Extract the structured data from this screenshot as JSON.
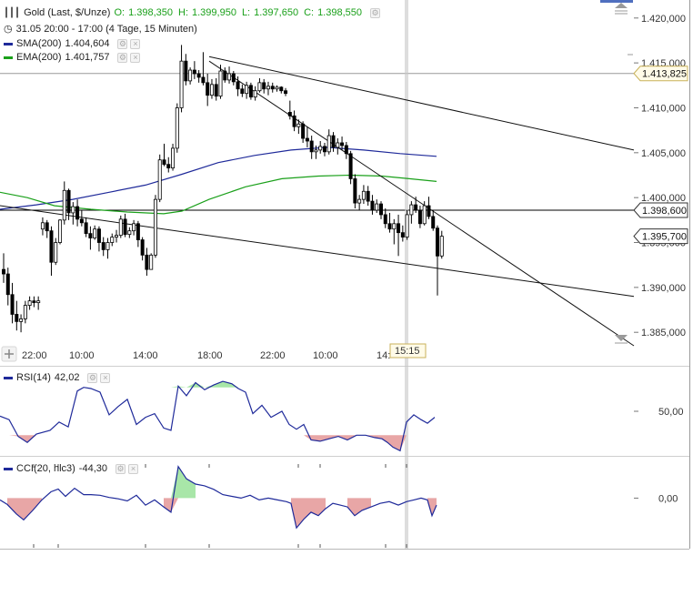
{
  "legend": {
    "main": {
      "title": "Gold (Last, $/Unze)",
      "o_label": "O:",
      "o": "1.398,350",
      "h_label": "H:",
      "h": "1.399,950",
      "l_label": "L:",
      "l": "1.397,650",
      "c_label": "C:",
      "c": "1.398,550"
    },
    "period": "31.05 20:00 - 17:00 (4 Tage, 15 Minuten)",
    "sma": {
      "label": "SMA(200)",
      "value": "1.404,604",
      "color": "#1f2a9a"
    },
    "ema": {
      "label": "EMA(200)",
      "value": "1.401,757",
      "color": "#1aa01a"
    },
    "rsi": {
      "label": "RSI(14)",
      "value": "42,02"
    },
    "cci": {
      "label": "CCI(20, hlc3)",
      "value": "-44,30"
    }
  },
  "price_axis": {
    "ticks": [
      "1.420,000",
      "1.415,000",
      "1.410,000",
      "1.405,000",
      "1.400,000",
      "1.395,000",
      "1.390,000",
      "1.385,000"
    ],
    "tick_values": [
      1420,
      1415,
      1410,
      1405,
      1400,
      1395,
      1390,
      1385
    ],
    "marker_hline": {
      "value": 1413.825,
      "label": "1.413,825"
    },
    "marker_last": {
      "value": 1398.6,
      "label": "1.398,600"
    },
    "marker_cursor": {
      "value": 1395.7,
      "label": "1.395,700"
    }
  },
  "time_axis": {
    "ticks": [
      "22:00",
      "10:00",
      "14:00",
      "18:00",
      "22:00",
      "10:00",
      "14:"
    ],
    "cursor_label": "15:15"
  },
  "rsi_axis": {
    "tick": "50,00",
    "tick_value": 50
  },
  "cci_axis": {
    "tick": "0,00",
    "tick_value": 0
  },
  "colors": {
    "up": "#ffffff",
    "down": "#000000",
    "sma": "#1f2a9a",
    "ema": "#1aa01a",
    "indicator": "#1f2a9a",
    "fill_up": "#a8e6a8",
    "fill_down": "#e8a6a6"
  },
  "chart_data": {
    "type": "candlestick",
    "ylim": [
      1383.5,
      1421.5
    ],
    "candles": [
      [
        1392,
        1393.8,
        1390.5,
        1391.5
      ],
      [
        1391.5,
        1392.2,
        1388,
        1389.2
      ],
      [
        1389.2,
        1390.5,
        1386,
        1387
      ],
      [
        1387,
        1388.5,
        1385.2,
        1386.2
      ],
      [
        1386.2,
        1387,
        1385,
        1386.5
      ],
      [
        1386.5,
        1388.5,
        1386,
        1388
      ],
      [
        1388,
        1389,
        1387.5,
        1388.5
      ],
      [
        1388.5,
        1389,
        1387.8,
        1388.3
      ],
      [
        1388.3,
        1389,
        1387.5,
        1388.5
      ],
      [
        1396.5,
        1397.8,
        1395.8,
        1397.2
      ],
      [
        1397.2,
        1397.5,
        1395.5,
        1396.3
      ],
      [
        1396.3,
        1396.8,
        1391.3,
        1392.8
      ],
      [
        1392.8,
        1395.5,
        1392.5,
        1395
      ],
      [
        1395,
        1397.6,
        1394.8,
        1397.5
      ],
      [
        1397.5,
        1401.8,
        1397,
        1400.8
      ],
      [
        1400.8,
        1401,
        1397.5,
        1398.3
      ],
      [
        1398.3,
        1399.5,
        1397,
        1399
      ],
      [
        1399,
        1399.8,
        1396.8,
        1397.6
      ],
      [
        1397.6,
        1398.6,
        1396.8,
        1397.2
      ],
      [
        1397.2,
        1397.8,
        1395.6,
        1396
      ],
      [
        1396,
        1396.8,
        1394.2,
        1395.5
      ],
      [
        1395.5,
        1396.9,
        1395.3,
        1396.5
      ],
      [
        1396.5,
        1396.8,
        1394,
        1395
      ],
      [
        1395,
        1395.6,
        1393.5,
        1394.2
      ],
      [
        1394.2,
        1395.5,
        1393.2,
        1395
      ],
      [
        1395,
        1396,
        1394.6,
        1395.6
      ],
      [
        1395.6,
        1396.4,
        1395,
        1395.8
      ],
      [
        1395.8,
        1398,
        1395.5,
        1397.6
      ],
      [
        1397.6,
        1398.2,
        1395.6,
        1395.9
      ],
      [
        1395.9,
        1396.7,
        1395.5,
        1396.3
      ],
      [
        1396.3,
        1397.5,
        1395.8,
        1397.1
      ],
      [
        1397.1,
        1397.4,
        1394.5,
        1395.3
      ],
      [
        1395.3,
        1395.6,
        1393,
        1393.6
      ],
      [
        1393.6,
        1394.4,
        1391.3,
        1392
      ],
      [
        1392,
        1393.8,
        1392,
        1393.6
      ],
      [
        1393.6,
        1400.3,
        1393.3,
        1399.8
      ],
      [
        1399.8,
        1404.8,
        1399.5,
        1404.2
      ],
      [
        1404.2,
        1406,
        1403.5,
        1403.7
      ],
      [
        1403.7,
        1404.5,
        1402.8,
        1403.3
      ],
      [
        1403.3,
        1406,
        1403,
        1405.5
      ],
      [
        1405.5,
        1410.5,
        1405,
        1410
      ],
      [
        1410,
        1417,
        1409.5,
        1415.2
      ],
      [
        1415.2,
        1416,
        1412.5,
        1413
      ],
      [
        1413,
        1414.5,
        1412.6,
        1414.2
      ],
      [
        1414.2,
        1415.2,
        1413.2,
        1413.8
      ],
      [
        1413.8,
        1414.2,
        1412.8,
        1413.4
      ],
      [
        1413.4,
        1416.2,
        1412.5,
        1412.8
      ],
      [
        1412.8,
        1413.8,
        1410.2,
        1411.4
      ],
      [
        1411.4,
        1413.2,
        1411,
        1412.6
      ],
      [
        1412.6,
        1413.3,
        1410.8,
        1411.3
      ],
      [
        1411.3,
        1414.8,
        1411,
        1414.1
      ],
      [
        1414.1,
        1414.5,
        1412.8,
        1413.1
      ],
      [
        1413.1,
        1414.6,
        1412.7,
        1413.8
      ],
      [
        1413.8,
        1414.1,
        1412.5,
        1412.9
      ],
      [
        1412.9,
        1413.5,
        1411.3,
        1412.1
      ],
      [
        1412.1,
        1412.6,
        1411.2,
        1411.6
      ],
      [
        1411.6,
        1412.9,
        1411,
        1412.5
      ],
      [
        1412.5,
        1412.8,
        1410.9,
        1411.2
      ],
      [
        1411.2,
        1412.4,
        1410.8,
        1411.9
      ],
      [
        1411.9,
        1413.3,
        1411.7,
        1412.8
      ],
      [
        1412.8,
        1413.2,
        1411.6,
        1412.1
      ],
      [
        1412.1,
        1412.9,
        1411.4,
        1412.4
      ],
      [
        1412.4,
        1412.8,
        1411.7,
        1412.1
      ],
      [
        1412.1,
        1412.5,
        1411.8,
        1412.3
      ],
      [
        1412.3,
        1412.4,
        1411.6,
        1411.9
      ],
      [
        1411.9,
        1412.2,
        1411.3,
        1411.6
      ],
      [
        1409.5,
        1410.8,
        1408.7,
        1409.1
      ],
      [
        1409.1,
        1409.7,
        1407.4,
        1407.9
      ],
      [
        1407.9,
        1408.7,
        1407.1,
        1408.2
      ],
      [
        1408.2,
        1408.5,
        1406.1,
        1406.6
      ],
      [
        1406.6,
        1407.9,
        1405.6,
        1406.3
      ],
      [
        1406.3,
        1406.9,
        1404.3,
        1405.1
      ],
      [
        1405.1,
        1405.8,
        1404.3,
        1405.3
      ],
      [
        1405.3,
        1406.3,
        1404.9,
        1405.7
      ],
      [
        1405.7,
        1406.1,
        1404.6,
        1405.1
      ],
      [
        1405.1,
        1407.6,
        1404.8,
        1406.9
      ],
      [
        1406.9,
        1407.3,
        1405.1,
        1405.6
      ],
      [
        1405.6,
        1406.6,
        1404.8,
        1406.1
      ],
      [
        1406.1,
        1406.8,
        1405.3,
        1405.8
      ],
      [
        1405.8,
        1406.2,
        1404.3,
        1404.9
      ],
      [
        1404.9,
        1405.2,
        1401.5,
        1402.1
      ],
      [
        1402.1,
        1402.6,
        1398.8,
        1399.4
      ],
      [
        1399.4,
        1400.3,
        1398.6,
        1399.8
      ],
      [
        1399.8,
        1401.4,
        1399.3,
        1400.7
      ],
      [
        1400.7,
        1401.3,
        1399.1,
        1399.6
      ],
      [
        1399.6,
        1400.3,
        1398.1,
        1398.6
      ],
      [
        1398.6,
        1399.8,
        1398.3,
        1399.3
      ],
      [
        1399.3,
        1399.6,
        1397.6,
        1398.1
      ],
      [
        1398.1,
        1398.8,
        1396.6,
        1397.1
      ],
      [
        1397.1,
        1398.3,
        1396.1,
        1396.5
      ],
      [
        1396.5,
        1397.6,
        1394.8,
        1397.1
      ],
      [
        1397.1,
        1398.1,
        1393.5,
        1396.1
      ],
      [
        1396.1,
        1396.9,
        1395.1,
        1395.6
      ],
      [
        1395.6,
        1398.6,
        1395.3,
        1398.1
      ],
      [
        1398.1,
        1399.6,
        1397.1,
        1399.2
      ],
      [
        1399.2,
        1400.1,
        1398.3,
        1398.6
      ],
      [
        1398.6,
        1399.1,
        1396.6,
        1397.1
      ],
      [
        1397.1,
        1399.6,
        1396.9,
        1399.1
      ],
      [
        1399.1,
        1400.1,
        1397.6,
        1397.9
      ],
      [
        1397.9,
        1398.6,
        1396.3,
        1396.6
      ],
      [
        1396.6,
        1396.9,
        1389.1,
        1393.5
      ],
      [
        1393.5,
        1396.3,
        1393.2,
        1395.7
      ]
    ],
    "sma": {
      "name": "SMA(200)",
      "points": [
        [
          0,
          1398.7
        ],
        [
          40,
          1399.2
        ],
        [
          80,
          1399.8
        ],
        [
          120,
          1400.6
        ],
        [
          160,
          1401.4
        ],
        [
          200,
          1402.6
        ],
        [
          240,
          1403.9
        ],
        [
          280,
          1404.7
        ],
        [
          320,
          1405.3
        ],
        [
          360,
          1405.6
        ],
        [
          400,
          1405.3
        ],
        [
          440,
          1404.9
        ],
        [
          480,
          1404.6
        ]
      ]
    },
    "ema": {
      "name": "EMA(200)",
      "points": [
        [
          0,
          1400.6
        ],
        [
          30,
          1400.0
        ],
        [
          60,
          1399.1
        ],
        [
          100,
          1398.7
        ],
        [
          140,
          1398.4
        ],
        [
          180,
          1398.2
        ],
        [
          200,
          1398.5
        ],
        [
          230,
          1399.8
        ],
        [
          270,
          1401.2
        ],
        [
          310,
          1402.1
        ],
        [
          350,
          1402.4
        ],
        [
          385,
          1402.5
        ],
        [
          420,
          1402.4
        ],
        [
          450,
          1402.1
        ],
        [
          480,
          1401.8
        ]
      ]
    },
    "trendlines": [
      {
        "from": [
          230,
          1415.7
        ],
        "to": [
          697,
          1405.3
        ]
      },
      {
        "from": [
          230,
          1415.2
        ],
        "to": [
          697,
          1383.5
        ]
      },
      {
        "from": [
          0,
          1399.1
        ],
        "to": [
          697,
          1389.0
        ]
      }
    ],
    "hlines": [
      1413.825,
      1398.6
    ],
    "cursor_x": 447,
    "rsi": {
      "ylim": [
        15,
        85
      ],
      "reference": 30,
      "upper": 70,
      "points": [
        [
          0,
          46
        ],
        [
          10,
          43
        ],
        [
          20,
          29
        ],
        [
          30,
          24
        ],
        [
          40,
          31
        ],
        [
          55,
          34
        ],
        [
          65,
          41
        ],
        [
          75,
          37
        ],
        [
          85,
          67
        ],
        [
          92,
          70
        ],
        [
          100,
          69
        ],
        [
          110,
          66
        ],
        [
          120,
          47
        ],
        [
          130,
          54
        ],
        [
          140,
          60
        ],
        [
          150,
          39
        ],
        [
          160,
          45
        ],
        [
          170,
          48
        ],
        [
          180,
          36
        ],
        [
          188,
          34
        ],
        [
          196,
          71
        ],
        [
          205,
          63
        ],
        [
          215,
          74
        ],
        [
          225,
          68
        ],
        [
          235,
          72
        ],
        [
          245,
          75
        ],
        [
          255,
          73
        ],
        [
          262,
          69
        ],
        [
          270,
          66
        ],
        [
          278,
          48
        ],
        [
          288,
          55
        ],
        [
          298,
          45
        ],
        [
          310,
          50
        ],
        [
          318,
          39
        ],
        [
          326,
          35
        ],
        [
          334,
          39
        ],
        [
          342,
          26
        ],
        [
          352,
          25
        ],
        [
          362,
          27
        ],
        [
          372,
          29
        ],
        [
          382,
          26
        ],
        [
          392,
          30
        ],
        [
          402,
          30
        ],
        [
          412,
          28
        ],
        [
          420,
          27
        ],
        [
          426,
          24
        ],
        [
          432,
          20
        ],
        [
          440,
          17
        ],
        [
          447,
          41
        ],
        [
          455,
          47
        ],
        [
          463,
          43
        ],
        [
          470,
          40
        ],
        [
          478,
          45
        ]
      ]
    },
    "cci": {
      "ylim": [
        -100,
        110
      ],
      "reference": 0,
      "points": [
        [
          0,
          -5
        ],
        [
          8,
          -18
        ],
        [
          18,
          -45
        ],
        [
          26,
          -62
        ],
        [
          36,
          -35
        ],
        [
          46,
          -5
        ],
        [
          56,
          18
        ],
        [
          64,
          26
        ],
        [
          72,
          5
        ],
        [
          82,
          28
        ],
        [
          92,
          10
        ],
        [
          100,
          10
        ],
        [
          110,
          8
        ],
        [
          120,
          2
        ],
        [
          130,
          -2
        ],
        [
          140,
          -8
        ],
        [
          150,
          8
        ],
        [
          160,
          -20
        ],
        [
          170,
          -5
        ],
        [
          180,
          -25
        ],
        [
          188,
          -40
        ],
        [
          196,
          90
        ],
        [
          205,
          55
        ],
        [
          215,
          40
        ],
        [
          225,
          35
        ],
        [
          235,
          25
        ],
        [
          245,
          10
        ],
        [
          255,
          5
        ],
        [
          265,
          0
        ],
        [
          275,
          8
        ],
        [
          285,
          -5
        ],
        [
          295,
          0
        ],
        [
          305,
          -5
        ],
        [
          315,
          -10
        ],
        [
          320,
          -15
        ],
        [
          326,
          -85
        ],
        [
          334,
          -60
        ],
        [
          342,
          -40
        ],
        [
          350,
          -50
        ],
        [
          358,
          -30
        ],
        [
          366,
          -15
        ],
        [
          374,
          -20
        ],
        [
          382,
          -25
        ],
        [
          390,
          -50
        ],
        [
          398,
          -35
        ],
        [
          408,
          -25
        ],
        [
          418,
          -15
        ],
        [
          428,
          -10
        ],
        [
          438,
          -20
        ],
        [
          447,
          -10
        ],
        [
          455,
          -5
        ],
        [
          463,
          0
        ],
        [
          470,
          -5
        ],
        [
          475,
          -50
        ],
        [
          480,
          -20
        ]
      ]
    }
  }
}
